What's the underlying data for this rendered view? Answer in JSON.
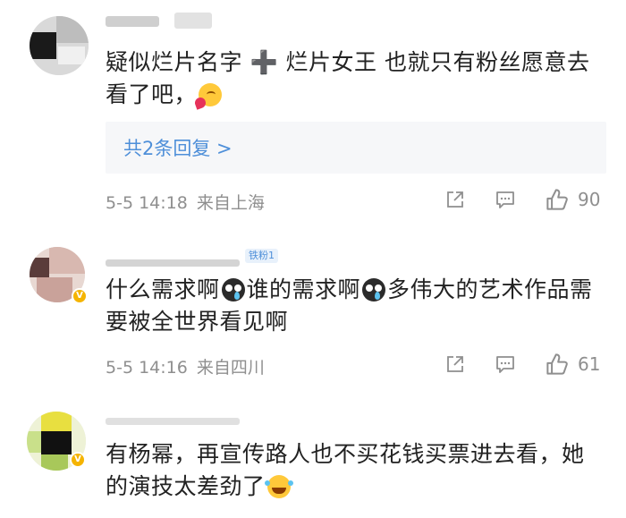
{
  "comments": [
    {
      "text_before": "疑似烂片名字 ➕ 烂片女王 也就只有粉丝愿意去看了吧，",
      "emoji": "cute-blush-heart-emoji",
      "replies_link": "共2条回复 >",
      "time": "5-5 14:18",
      "location": "来自上海",
      "likes": "90"
    },
    {
      "segment1": "什么需求啊",
      "segment2": "谁的需求啊",
      "segment3": "多伟大的艺术作品需要被全世界看见啊",
      "fan_badge": "铁粉1",
      "verified_badge": "V",
      "time": "5-5 14:16",
      "location": "来自四川",
      "likes": "61"
    },
    {
      "text": "有杨幂，再宣传路人也不买花钱买票进去看，她的演技太差劲了",
      "verified_badge": "V"
    }
  ],
  "icons": {
    "share": "share-icon",
    "comment": "comment-icon",
    "like": "thumbs-up-icon"
  },
  "colors": {
    "link": "#4e8fd9",
    "meta": "#8f8f8f",
    "reply_bg": "#f6f7f9",
    "badge": "#f5b400"
  }
}
